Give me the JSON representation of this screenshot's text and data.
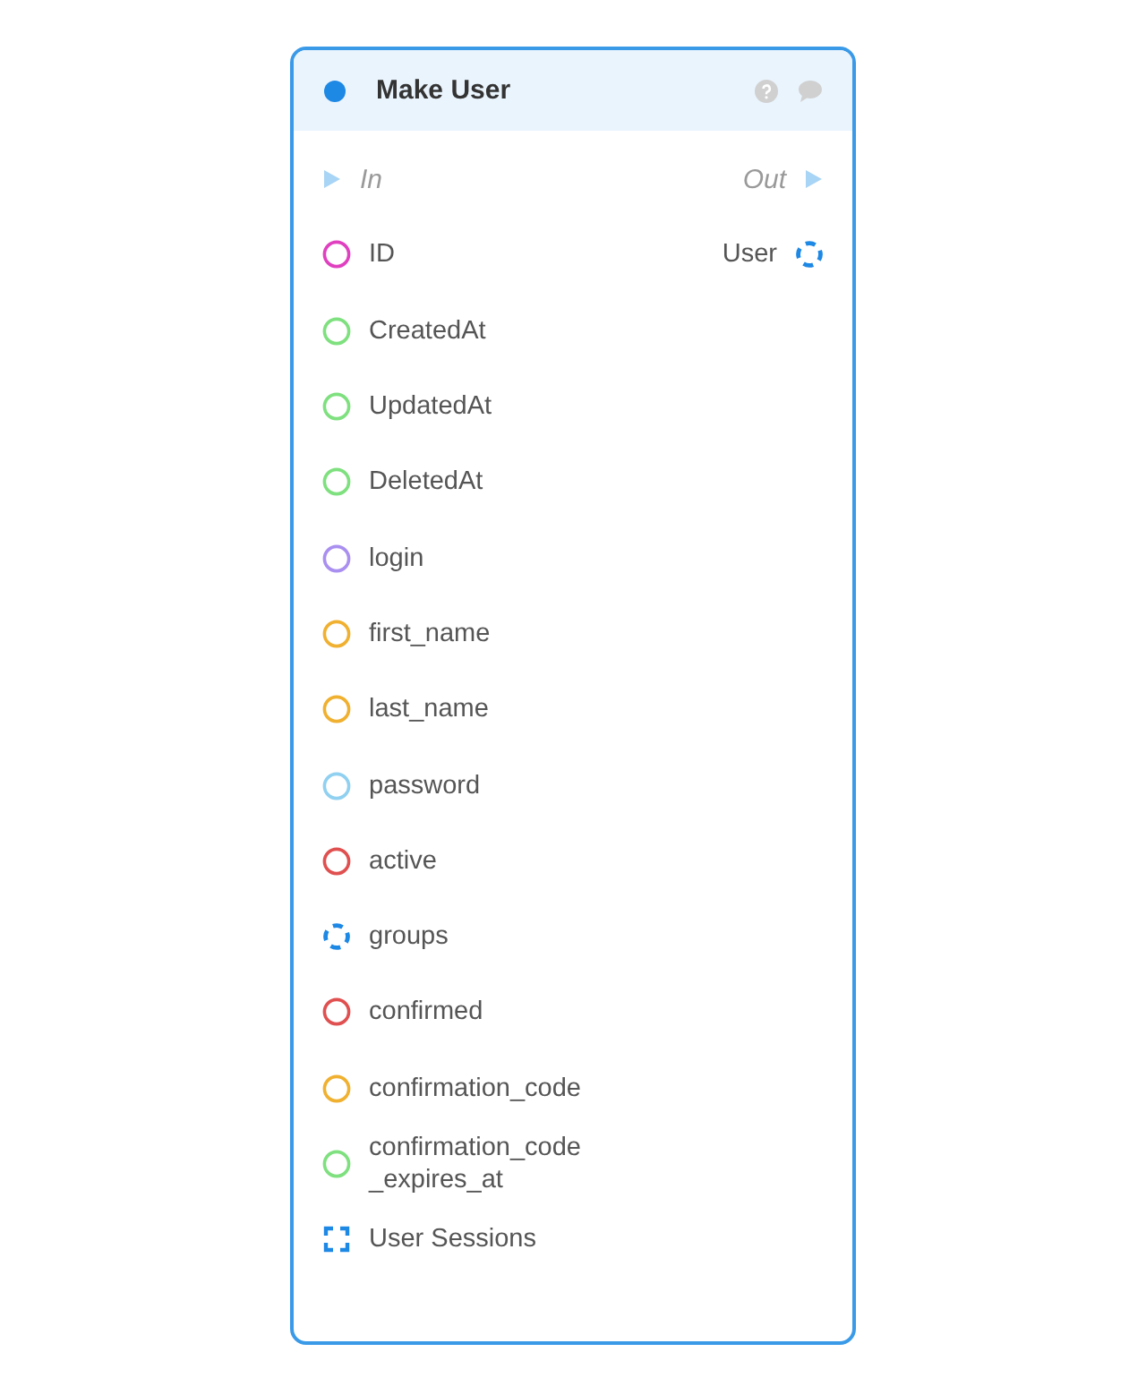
{
  "node": {
    "title": "Make User",
    "exec": {
      "in": "In",
      "out": "Out"
    },
    "outputs": [
      {
        "label": "User",
        "kind": "collection",
        "color": "#1e88e5"
      }
    ],
    "inputs": [
      {
        "label": "ID",
        "kind": "circle",
        "color": "#e040c0"
      },
      {
        "label": "CreatedAt",
        "kind": "circle",
        "color": "#7ee07e"
      },
      {
        "label": "UpdatedAt",
        "kind": "circle",
        "color": "#7ee07e"
      },
      {
        "label": "DeletedAt",
        "kind": "circle",
        "color": "#7ee07e"
      },
      {
        "label": "login",
        "kind": "circle",
        "color": "#a98ff0"
      },
      {
        "label": "first_name",
        "kind": "circle",
        "color": "#f0b030"
      },
      {
        "label": "last_name",
        "kind": "circle",
        "color": "#f0b030"
      },
      {
        "label": "password",
        "kind": "circle",
        "color": "#90d0f0"
      },
      {
        "label": "active",
        "kind": "circle",
        "color": "#e05050"
      },
      {
        "label": "groups",
        "kind": "collection",
        "color": "#1e88e5"
      },
      {
        "label": "confirmed",
        "kind": "circle",
        "color": "#e05050"
      },
      {
        "label": "confirmation_code",
        "kind": "circle",
        "color": "#f0b030"
      },
      {
        "label": "confirmation_code\n_expires_at",
        "kind": "circle",
        "color": "#7ee07e"
      },
      {
        "label": "User Sessions",
        "kind": "list",
        "color": "#1e88e5"
      }
    ]
  }
}
